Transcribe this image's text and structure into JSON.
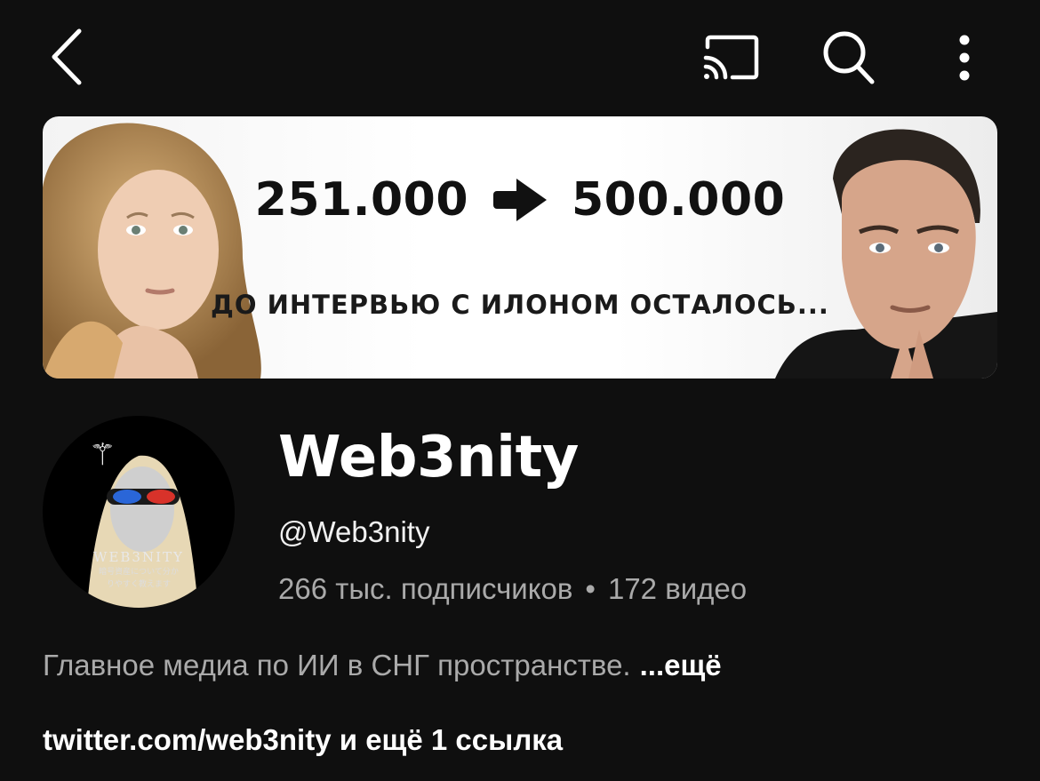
{
  "header": {
    "icons": [
      "back-icon",
      "cast-icon",
      "search-icon",
      "more-vert-icon"
    ]
  },
  "banner": {
    "from_count": "251.000",
    "to_count": "500.000",
    "subtitle": "ДО ИНТЕРВЬЮ С ИЛОНОМ ОСТАЛОСЬ..."
  },
  "avatar": {
    "brand_text": "WEB3NITY"
  },
  "channel": {
    "name": "Web3nity",
    "handle": "@Web3nity",
    "subscribers": "266 тыс. подписчиков",
    "separator": "•",
    "videos": "172 видео",
    "description": "Главное медиа по ИИ в СНГ пространстве.",
    "more_label": "...ещё",
    "links": "twitter.com/web3nity и ещё 1 ссылка"
  },
  "colors": {
    "background": "#0f0f0f",
    "primary_text": "#ffffff",
    "secondary_text": "#aaaaaa"
  }
}
